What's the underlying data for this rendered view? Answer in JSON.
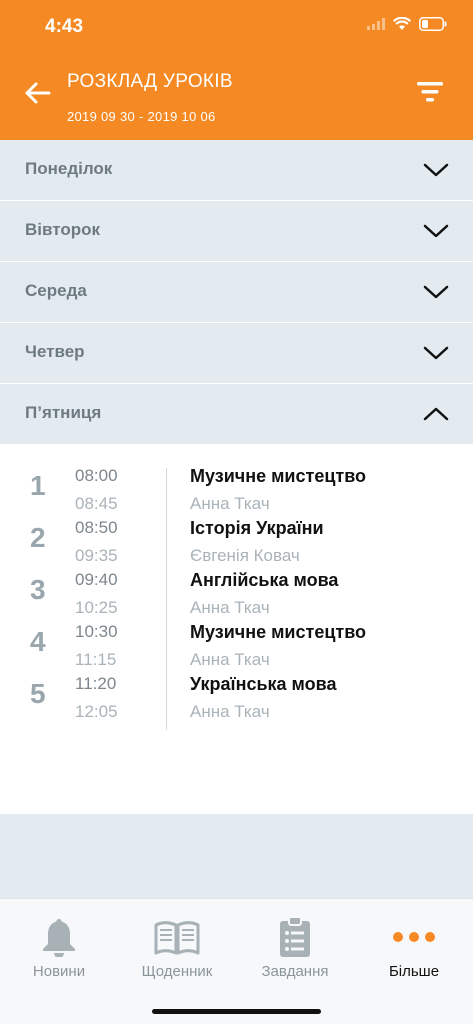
{
  "status_bar": {
    "time": "4:43"
  },
  "header": {
    "title": "РОЗКЛАД УРОКІВ",
    "date_range": "2019 09 30 - 2019 10 06"
  },
  "days": [
    {
      "label": "Понеділок",
      "expanded": false
    },
    {
      "label": "Вівторок",
      "expanded": false
    },
    {
      "label": "Середа",
      "expanded": false
    },
    {
      "label": "Четвер",
      "expanded": false
    },
    {
      "label": "П’ятниця",
      "expanded": true
    }
  ],
  "lessons": [
    {
      "num": "1",
      "start": "08:00",
      "end": "08:45",
      "subject": "Музичне мистецтво",
      "teacher": "Анна Ткач"
    },
    {
      "num": "2",
      "start": "08:50",
      "end": "09:35",
      "subject": "Історія України",
      "teacher": "Євгенія Ковач"
    },
    {
      "num": "3",
      "start": "09:40",
      "end": "10:25",
      "subject": "Англійська мова",
      "teacher": "Анна Ткач"
    },
    {
      "num": "4",
      "start": "10:30",
      "end": "11:15",
      "subject": "Музичне мистецтво",
      "teacher": "Анна Ткач"
    },
    {
      "num": "5",
      "start": "11:20",
      "end": "12:05",
      "subject": "Українська мова",
      "teacher": "Анна Ткач"
    }
  ],
  "tabbar": {
    "tabs": [
      {
        "label": "Новини",
        "icon": "bell-icon",
        "active": false
      },
      {
        "label": "Щоденник",
        "icon": "book-icon",
        "active": false
      },
      {
        "label": "Завдання",
        "icon": "clipboard-icon",
        "active": false
      },
      {
        "label": "Більше",
        "icon": "more-dots-icon",
        "active": true
      }
    ]
  },
  "colors": {
    "accent": "#f58a24",
    "row_bg": "#e3ebf0",
    "day_text": "#6e7a82"
  }
}
